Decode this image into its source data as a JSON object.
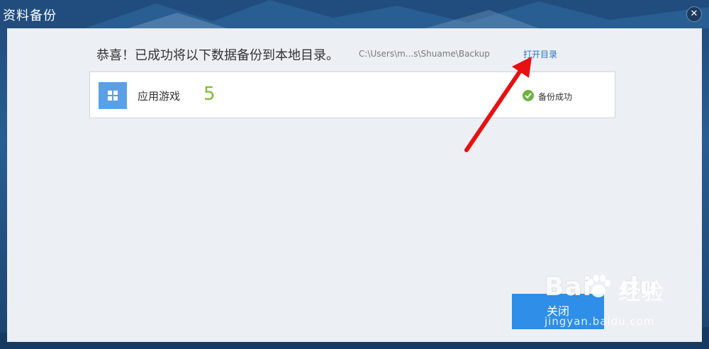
{
  "window": {
    "title": "资料备份",
    "close_glyph": "✕"
  },
  "main": {
    "message": "恭喜！已成功将以下数据备份到本地目录。",
    "path": "C:\\Users\\m...s\\Shuame\\Backup",
    "open_dir_label": "打开目录"
  },
  "item": {
    "icon": "apps-grid-icon",
    "label": "应用游戏",
    "count": "5",
    "status_icon": "check-circle-icon",
    "status_label": "备份成功"
  },
  "footer": {
    "close_label": "关闭"
  },
  "watermark": {
    "logo_left": "Bai",
    "logo_right": "du",
    "text": "经验",
    "url": "jingyan.baidu.com"
  },
  "colors": {
    "accent": "#2e8ee8",
    "link": "#2a73c8",
    "success": "#6db33f",
    "count": "#7bbd2a",
    "annotation_arrow": "#e81010"
  }
}
